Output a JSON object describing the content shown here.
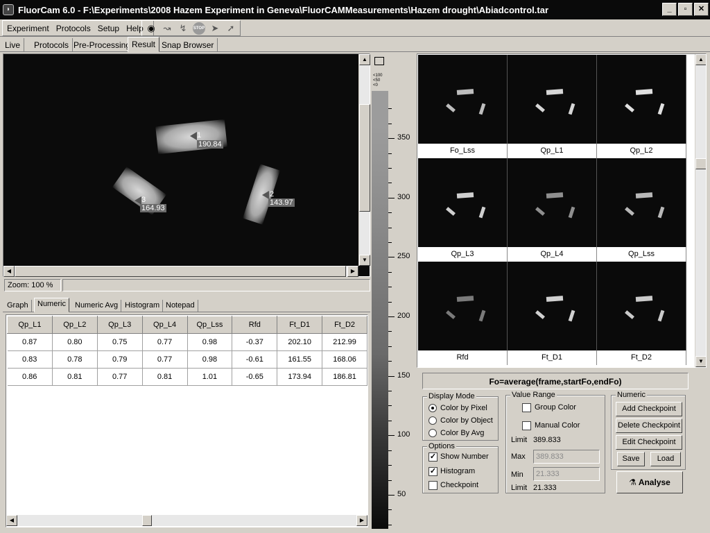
{
  "window": {
    "title": "FluorCam 6.0 - F:\\Experiments\\2008 Hazem Experiment in Geneva\\FluorCAMMeasurements\\Hazem drought\\Abiadcontrol.tar",
    "buttons": [
      "_",
      "▫",
      "✕"
    ]
  },
  "menu": [
    {
      "label": "Experiment"
    },
    {
      "label": "Protocols"
    },
    {
      "label": "Setup"
    },
    {
      "label": "Help"
    }
  ],
  "toolbar": {
    "icons": [
      "camera-icon",
      "chart-arrow-icon",
      "flash-icon",
      "stop-icon",
      "forward-icon",
      "arrow-icon"
    ],
    "stop_label": "STOP"
  },
  "main_tabs": [
    "Live",
    "Protocols",
    "Pre-Processing",
    "Result",
    "Snap Browser"
  ],
  "main_tabs_active": "Result",
  "image": {
    "objects": [
      {
        "num": "1",
        "value": "190.84"
      },
      {
        "num": "2",
        "value": "143.97"
      },
      {
        "num": "3",
        "value": "164.93"
      }
    ]
  },
  "zoom": {
    "label": "Zoom: 100 %"
  },
  "sub_tabs": [
    "Graph",
    "Numeric",
    "Numeric Avg",
    "Histogram",
    "Notepad"
  ],
  "sub_tabs_active": "Numeric",
  "table": {
    "headers": [
      "Qp_L1",
      "Qp_L2",
      "Qp_L3",
      "Qp_L4",
      "Qp_Lss",
      "Rfd",
      "Ft_D1",
      "Ft_D2"
    ],
    "rows": [
      [
        "0.87",
        "0.80",
        "0.75",
        "0.77",
        "0.98",
        "-0.37",
        "202.10",
        "212.99"
      ],
      [
        "0.83",
        "0.78",
        "0.79",
        "0.77",
        "0.98",
        "-0.61",
        "161.55",
        "168.06"
      ],
      [
        "0.86",
        "0.81",
        "0.77",
        "0.81",
        "1.01",
        "-0.65",
        "173.94",
        "186.81"
      ]
    ]
  },
  "colorbar": {
    "mini_text": [
      "<100",
      "<50",
      "<0"
    ],
    "labels": [
      "350",
      "300",
      "250",
      "200",
      "150",
      "100",
      "50"
    ],
    "label_values": [
      350,
      300,
      250,
      200,
      150,
      100,
      50
    ],
    "range": [
      21.333,
      389.833
    ]
  },
  "thumbnails": [
    "Fo_Lss",
    "Qp_L1",
    "Qp_L2",
    "Qp_L3",
    "Qp_L4",
    "Qp_Lss",
    "Rfd",
    "Ft_D1",
    "Ft_D2"
  ],
  "formula": "Fo=average(frame,startFo,endFo)",
  "display_mode": {
    "title": "Display Mode",
    "options": [
      "Color by Pixel",
      "Color by Object",
      "Color By Avg"
    ],
    "selected": "Color by Pixel"
  },
  "options": {
    "title": "Options",
    "items": [
      {
        "label": "Show Number",
        "checked": true
      },
      {
        "label": "Histogram",
        "checked": true
      },
      {
        "label": "Checkpoint",
        "checked": false
      }
    ]
  },
  "value_range": {
    "title": "Value Range",
    "group_color": "Group Color",
    "manual_color": "Manual Color",
    "limit_top_label": "Limit",
    "limit_top": "389.833",
    "max_label": "Max",
    "max_value": "389.833",
    "min_label": "Min",
    "min_value": "21.333",
    "limit_bottom_label": "Limit",
    "limit_bottom": "21.333"
  },
  "numeric": {
    "title": "Numeric",
    "add": "Add Checkpoint",
    "delete": "Delete Checkpoint",
    "edit": "Edit Checkpoint",
    "save": "Save",
    "load": "Load",
    "analyse": "Analyse"
  }
}
